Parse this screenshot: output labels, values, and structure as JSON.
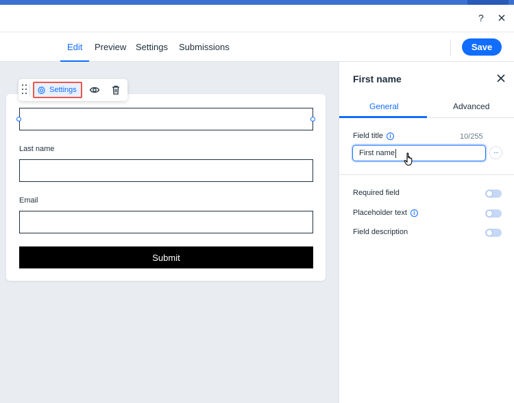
{
  "window": {
    "help_icon": "question-mark-icon",
    "close_icon": "close-icon"
  },
  "nav": {
    "tabs": [
      {
        "label": "Edit",
        "active": true
      },
      {
        "label": "Preview",
        "active": false
      },
      {
        "label": "Settings",
        "active": false
      },
      {
        "label": "Submissions",
        "active": false
      }
    ],
    "save_label": "Save"
  },
  "toolbar": {
    "settings_label": "Settings",
    "icons": [
      "drag-handle-icon",
      "gear-icon",
      "eye-icon",
      "trash-icon"
    ]
  },
  "form": {
    "fields": [
      {
        "label": "",
        "value": ""
      },
      {
        "label": "Last name",
        "value": ""
      },
      {
        "label": "Email",
        "value": ""
      }
    ],
    "submit_label": "Submit"
  },
  "panel": {
    "title": "First name",
    "tabs": [
      {
        "label": "General",
        "active": true
      },
      {
        "label": "Advanced",
        "active": false
      }
    ],
    "field_title_label": "Field title",
    "char_counter": "10/255",
    "field_title_value": "First name",
    "more_label": "···",
    "toggles": [
      {
        "label": "Required field",
        "info": false,
        "on": false
      },
      {
        "label": "Placeholder text",
        "info": true,
        "on": false
      },
      {
        "label": "Field description",
        "info": false,
        "on": false
      }
    ]
  },
  "colors": {
    "accent": "#116dff",
    "highlight_border": "#e8574a",
    "canvas_bg": "#e9edf1",
    "submit_bg": "#000000"
  }
}
